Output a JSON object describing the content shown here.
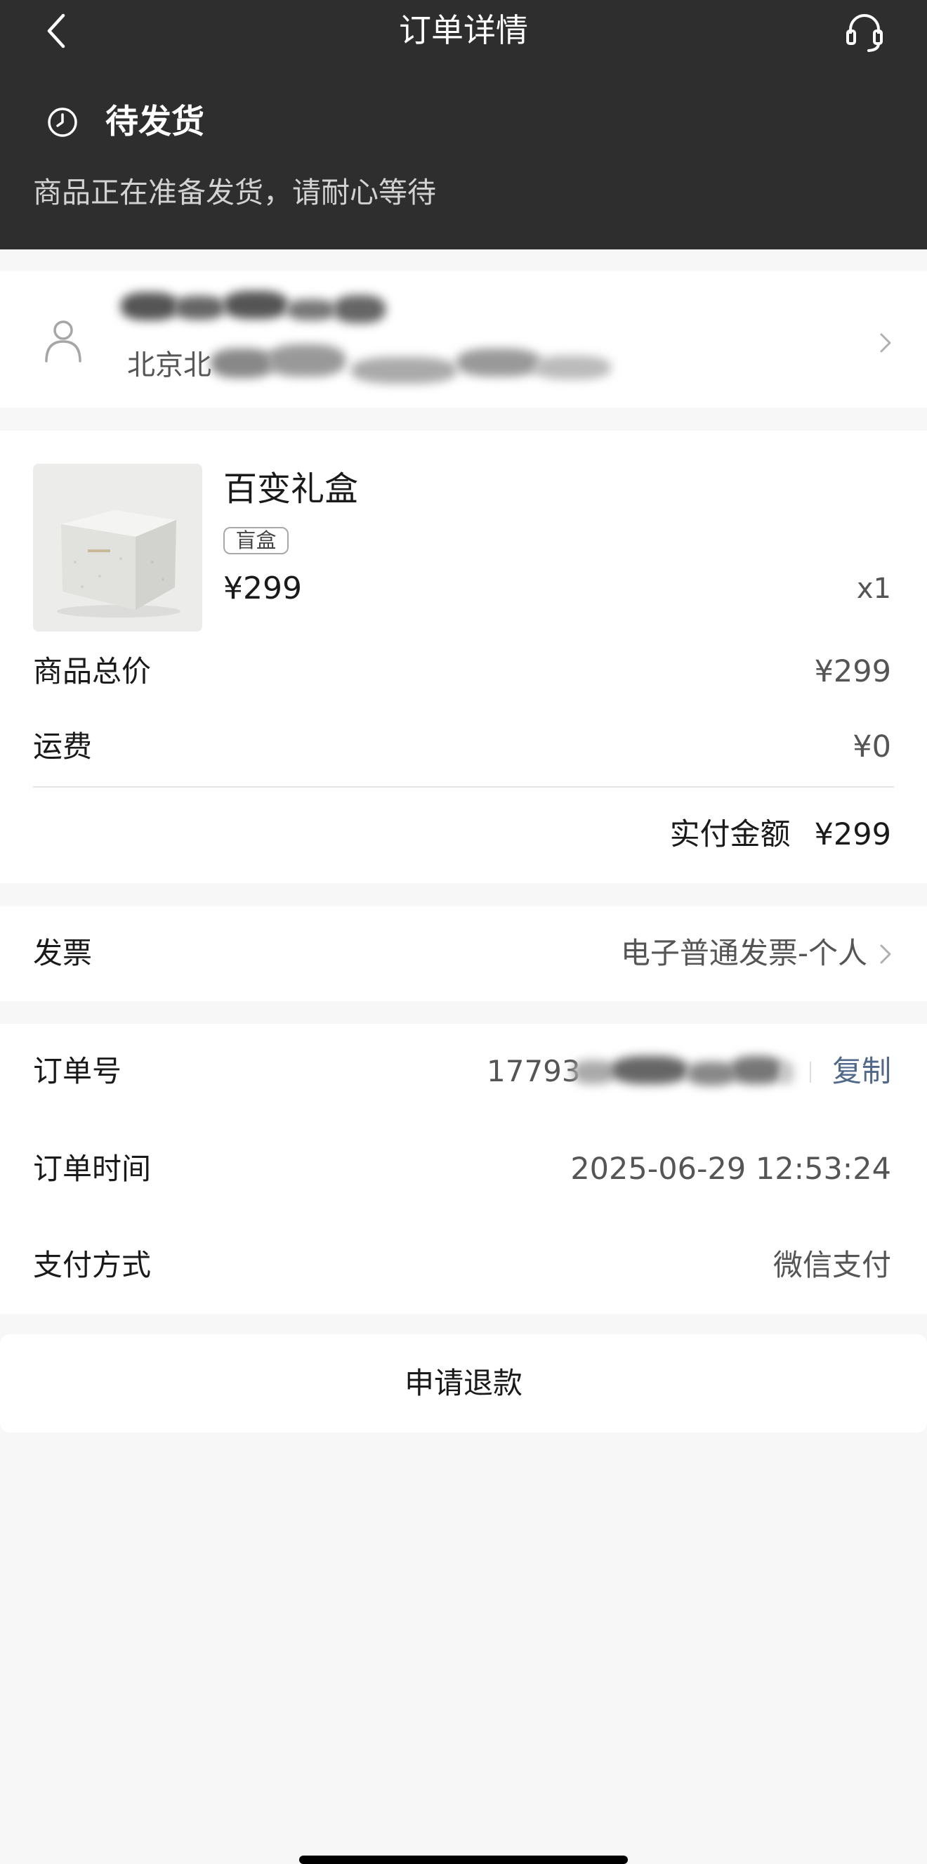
{
  "header": {
    "title": "订单详情",
    "back_icon": "chevron-left-icon",
    "service_icon": "headset-icon",
    "status": {
      "icon": "clock-icon",
      "label": "待发货",
      "message": "商品正在准备发货，请耐心等待"
    }
  },
  "address": {
    "icon": "person-icon",
    "address_visible": "北京北"
  },
  "product": {
    "name": "百变礼盒",
    "tag": "盲盒",
    "price": "¥299",
    "quantity": "x1"
  },
  "summary": {
    "subtotal_label": "商品总价",
    "subtotal": "¥299",
    "shipping_label": "运费",
    "shipping": "¥0",
    "paid_label": "实付金额",
    "paid": "¥299"
  },
  "invoice": {
    "label": "发票",
    "value": "电子普通发票-个人"
  },
  "order": {
    "number_label": "订单号",
    "number_visible": "17793",
    "copy_label": "复制",
    "time_label": "订单时间",
    "time": "2025-06-29 12:53:24",
    "payment_label": "支付方式",
    "payment": "微信支付"
  },
  "actions": {
    "refund_label": "申请退款"
  },
  "colors": {
    "header_bg": "#2e2e2e",
    "page_bg": "#f7f7f7",
    "copy_link": "#50698a"
  }
}
